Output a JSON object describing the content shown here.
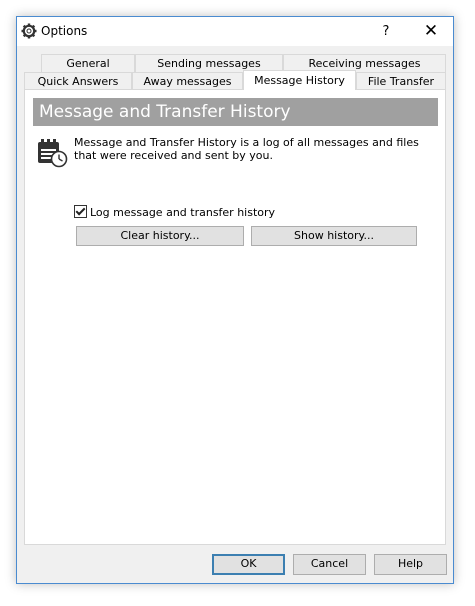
{
  "window": {
    "title": "Options",
    "help_glyph": "?",
    "close_glyph": "✕"
  },
  "tabs": {
    "row1": [
      {
        "label": "General"
      },
      {
        "label": "Sending messages"
      },
      {
        "label": "Receiving messages"
      }
    ],
    "row2": [
      {
        "label": "Quick Answers"
      },
      {
        "label": "Away messages"
      },
      {
        "label": "Message History",
        "active": true
      },
      {
        "label": "File Transfer"
      }
    ]
  },
  "panel": {
    "header": "Message and Transfer History",
    "description": "Message and Transfer History is a log of all messages and files that were received and sent by you.",
    "icon": "calendar-clock-icon",
    "log_checkbox": {
      "label": "Log message and transfer history",
      "checked": true
    },
    "clear_history_label": "Clear history...",
    "show_history_label": "Show history..."
  },
  "footer": {
    "ok_label": "OK",
    "cancel_label": "Cancel",
    "help_label": "Help"
  },
  "colors": {
    "accent": "#3c7fb1",
    "header_bg": "#a0a0a0",
    "window_border": "#4a8bd0"
  }
}
